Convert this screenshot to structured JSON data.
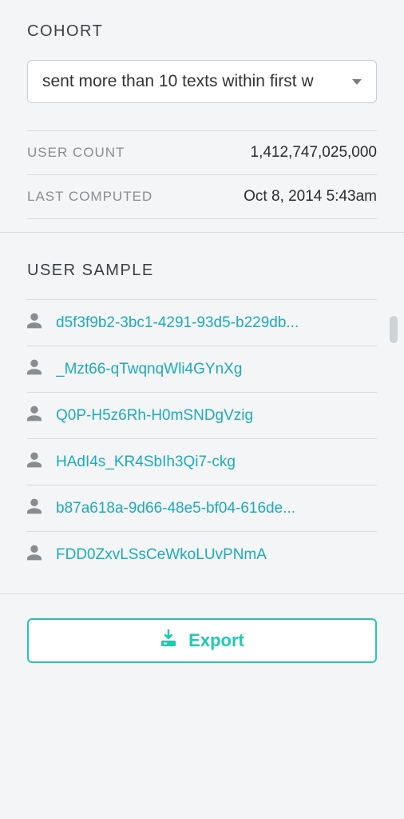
{
  "cohort": {
    "title": "COHORT",
    "dropdown_value": "sent more than 10 texts within first w",
    "stats": {
      "user_count_label": "USER COUNT",
      "user_count_value": "1,412,747,025,000",
      "last_computed_label": "LAST COMPUTED",
      "last_computed_value": "Oct 8, 2014 5:43am"
    }
  },
  "user_sample": {
    "title": "USER SAMPLE",
    "items": [
      "d5f3f9b2-3bc1-4291-93d5-b229db...",
      "_Mzt66-qTwqnqWli4GYnXg",
      "Q0P-H5z6Rh-H0mSNDgVzig",
      "HAdI4s_KR4SbIh3Qi7-ckg",
      "b87a618a-9d66-48e5-bf04-616de...",
      "FDD0ZxvLSsCeWkoLUvPNmA"
    ]
  },
  "export": {
    "label": "Export"
  }
}
